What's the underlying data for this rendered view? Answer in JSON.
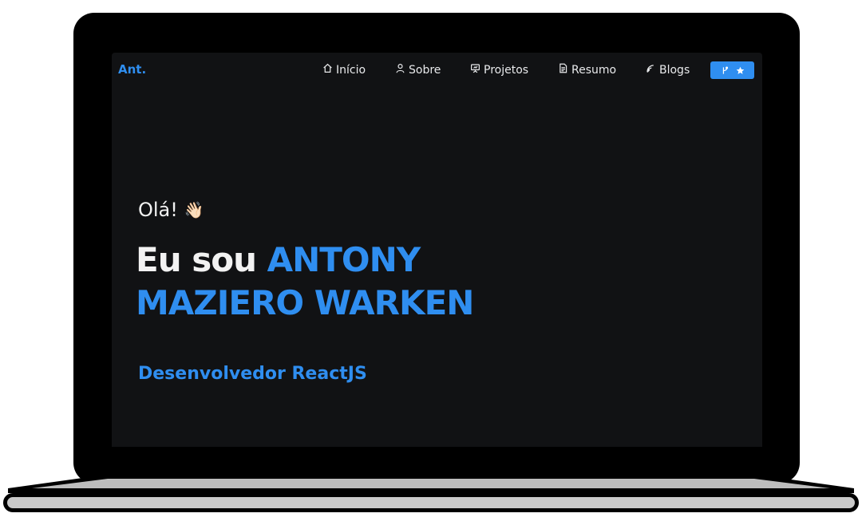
{
  "brand": {
    "label": "Ant."
  },
  "nav": {
    "items": [
      {
        "label": "Início",
        "icon": "home-icon"
      },
      {
        "label": "Sobre",
        "icon": "user-icon"
      },
      {
        "label": "Projetos",
        "icon": "presentation-icon"
      },
      {
        "label": "Resumo",
        "icon": "document-icon"
      },
      {
        "label": "Blogs",
        "icon": "feed-icon"
      }
    ],
    "github_button": {
      "icons": [
        "git-fork-icon",
        "star-icon"
      ]
    }
  },
  "hero": {
    "greeting": "Olá!",
    "wave_emoji": "👋🏻",
    "intro": "Eu sou",
    "name_part1": "ANTONY",
    "name_part2": "MAZIERO WARKEN",
    "role": "Desenvolvedor ReactJS"
  },
  "colors": {
    "accent": "#2f8ef0",
    "background": "#111214",
    "text": "#f2f2f2"
  }
}
